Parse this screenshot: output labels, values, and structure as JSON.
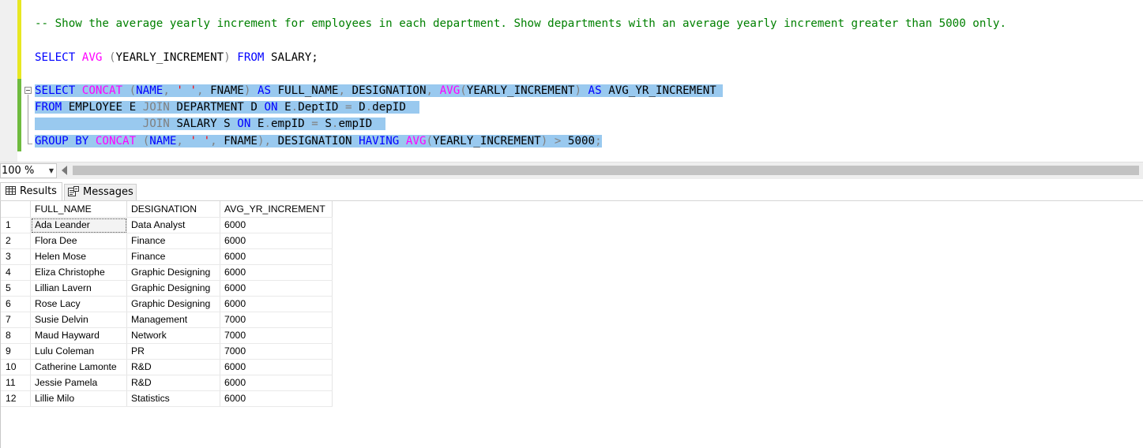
{
  "editor": {
    "comment": "-- Show the average yearly increment for employees in each department. Show departments with an average yearly increment greater than 5000 only.",
    "query1": {
      "kw_select": "SELECT",
      "fn_avg": "AVG",
      "paren_open": "(",
      "arg": "YEARLY_INCREMENT",
      "paren_close": ")",
      "kw_from": "FROM",
      "table": "SALARY;"
    },
    "query2": {
      "l1": {
        "kw_select": "SELECT",
        "fn_concat": "CONCAT",
        "p1": "(",
        "name": "NAME",
        "comma1": ",",
        "str": "' '",
        "comma2": ",",
        "fname": "FNAME",
        "p2": ")",
        "kw_as": "AS",
        "alias": "FULL_NAME",
        "comma3": ",",
        "desig": "DESIGNATION",
        "comma4": ",",
        "fn_avg": "AVG",
        "p3": "(",
        "yi": "YEARLY_INCREMENT",
        "p4": ")",
        "kw_as2": "AS",
        "alias2": "AVG_YR_INCREMENT"
      },
      "l2": {
        "kw_from": "FROM",
        "tbl": "EMPLOYEE E",
        "kw_join": "JOIN",
        "tbl2": "DEPARTMENT D",
        "kw_on": "ON",
        "left": "E",
        "dot1": ".",
        "col1": "DeptID",
        "eq": "=",
        "right": "D",
        "dot2": ".",
        "col2": "depID"
      },
      "l3": {
        "kw_join": "JOIN",
        "tbl": "SALARY S",
        "kw_on": "ON",
        "left": "E",
        "dot1": ".",
        "col1": "empID",
        "eq": "=",
        "right": "S",
        "dot2": ".",
        "col2": "empID"
      },
      "l4": {
        "kw_group": "GROUP BY",
        "fn_concat": "CONCAT",
        "p1": "(",
        "name": "NAME",
        "comma1": ",",
        "str": "' '",
        "comma2": ",",
        "fname": "FNAME",
        "p2": ")",
        "comma3": ",",
        "desig": "DESIGNATION",
        "kw_having": "HAVING",
        "fn_avg": "AVG",
        "p3": "(",
        "yi": "YEARLY_INCREMENT",
        "p4": ")",
        "gt": ">",
        "num": "5000",
        "semi": ";"
      }
    }
  },
  "zoom": {
    "value": "100 %"
  },
  "tabs": {
    "results": "Results",
    "messages": "Messages"
  },
  "grid": {
    "columns": [
      "FULL_NAME",
      "DESIGNATION",
      "AVG_YR_INCREMENT"
    ],
    "rows": [
      {
        "num": "1",
        "full_name": "Ada Leander",
        "designation": "Data Analyst",
        "avg": "6000"
      },
      {
        "num": "2",
        "full_name": "Flora Dee",
        "designation": "Finance",
        "avg": "6000"
      },
      {
        "num": "3",
        "full_name": "Helen Mose",
        "designation": "Finance",
        "avg": "6000"
      },
      {
        "num": "4",
        "full_name": "Eliza Christophe",
        "designation": "Graphic Designing",
        "avg": "6000"
      },
      {
        "num": "5",
        "full_name": "Lillian Lavern",
        "designation": "Graphic Designing",
        "avg": "6000"
      },
      {
        "num": "6",
        "full_name": "Rose Lacy",
        "designation": "Graphic Designing",
        "avg": "6000"
      },
      {
        "num": "7",
        "full_name": "Susie Delvin",
        "designation": "Management",
        "avg": "7000"
      },
      {
        "num": "8",
        "full_name": "Maud Hayward",
        "designation": "Network",
        "avg": "7000"
      },
      {
        "num": "9",
        "full_name": "Lulu Coleman",
        "designation": "PR",
        "avg": "7000"
      },
      {
        "num": "10",
        "full_name": "Catherine Lamonte",
        "designation": "R&D",
        "avg": "6000"
      },
      {
        "num": "11",
        "full_name": "Jessie Pamela",
        "designation": "R&D",
        "avg": "6000"
      },
      {
        "num": "12",
        "full_name": "Lillie Milo",
        "designation": "Statistics",
        "avg": "6000"
      }
    ]
  },
  "colors": {
    "keyword": "#0000ff",
    "function": "#ff00ff",
    "operator": "#808080",
    "string": "#ff0000",
    "comment": "#008000",
    "selection": "#99c9ef"
  }
}
